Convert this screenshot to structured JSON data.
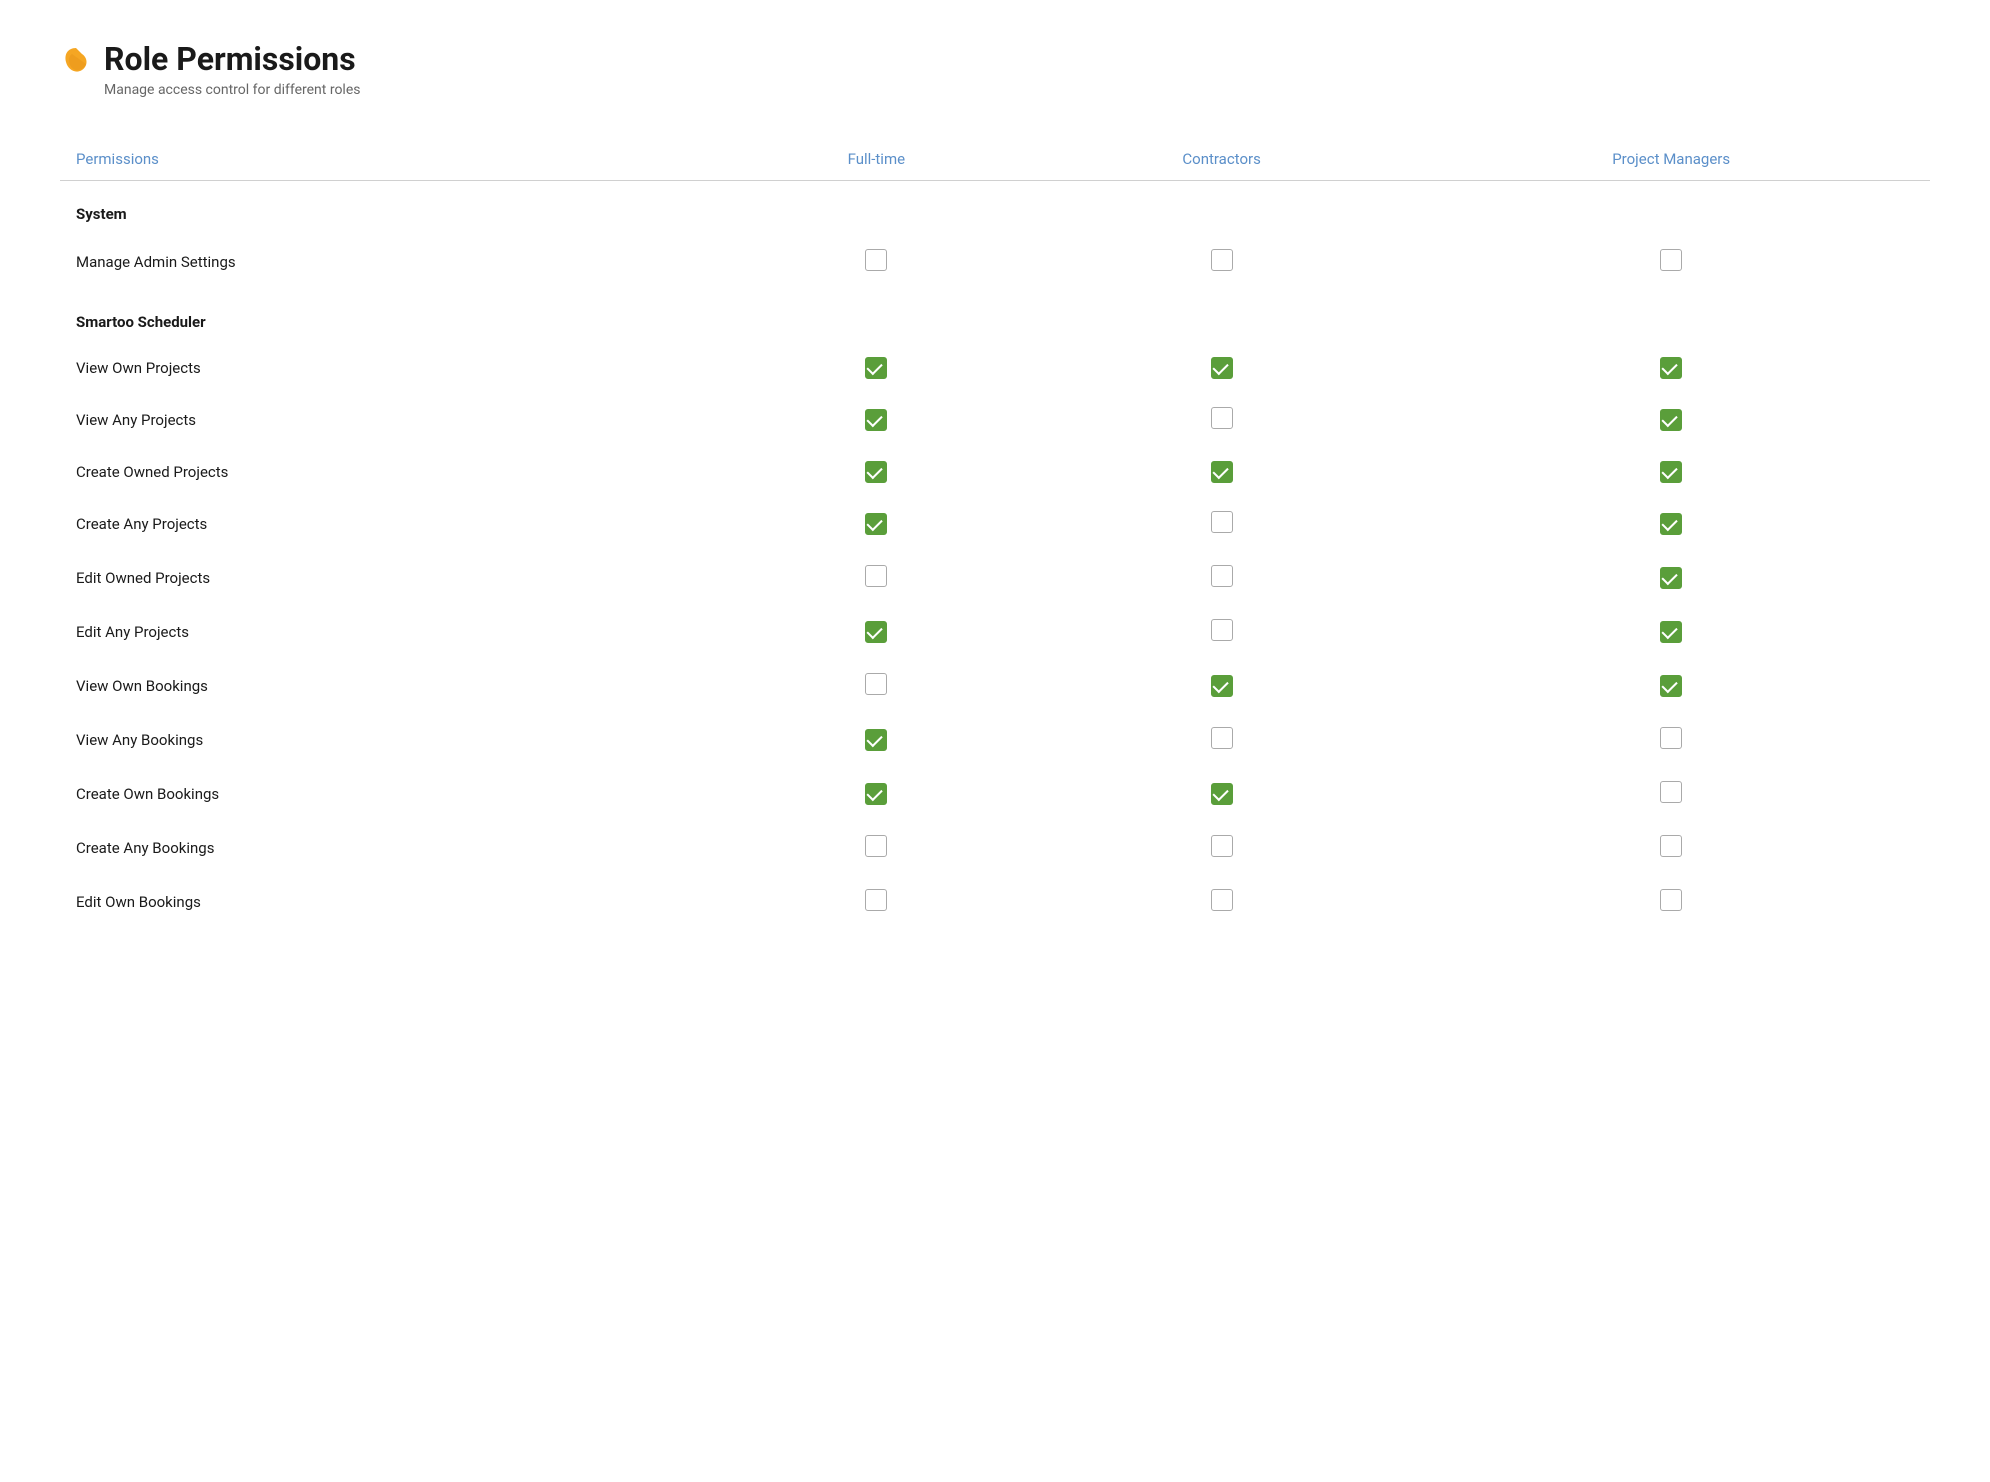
{
  "header": {
    "title": "Role Permissions",
    "subtitle": "Manage access control for different roles"
  },
  "table": {
    "columns": [
      {
        "key": "permission",
        "label": "Permissions"
      },
      {
        "key": "fulltime",
        "label": "Full-time"
      },
      {
        "key": "contractors",
        "label": "Contractors"
      },
      {
        "key": "project_managers",
        "label": "Project Managers"
      }
    ],
    "sections": [
      {
        "name": "System",
        "rows": [
          {
            "label": "Manage Admin Settings",
            "fulltime": false,
            "contractors": false,
            "project_managers": false
          }
        ]
      },
      {
        "name": "Smartoo Scheduler",
        "rows": [
          {
            "label": "View Own Projects",
            "fulltime": true,
            "contractors": true,
            "project_managers": true
          },
          {
            "label": "View Any Projects",
            "fulltime": true,
            "contractors": false,
            "project_managers": true
          },
          {
            "label": "Create Owned Projects",
            "fulltime": true,
            "contractors": true,
            "project_managers": true
          },
          {
            "label": "Create Any Projects",
            "fulltime": true,
            "contractors": false,
            "project_managers": true
          },
          {
            "label": "Edit Owned Projects",
            "fulltime": false,
            "contractors": false,
            "project_managers": true
          },
          {
            "label": "Edit Any Projects",
            "fulltime": true,
            "contractors": false,
            "project_managers": true
          },
          {
            "label": "View Own Bookings",
            "fulltime": false,
            "contractors": true,
            "project_managers": true
          },
          {
            "label": "View Any Bookings",
            "fulltime": true,
            "contractors": false,
            "project_managers": false
          },
          {
            "label": "Create Own Bookings",
            "fulltime": true,
            "contractors": true,
            "project_managers": false
          },
          {
            "label": "Create Any Bookings",
            "fulltime": false,
            "contractors": false,
            "project_managers": false
          },
          {
            "label": "Edit Own Bookings",
            "fulltime": false,
            "contractors": false,
            "project_managers": false
          }
        ]
      }
    ]
  }
}
